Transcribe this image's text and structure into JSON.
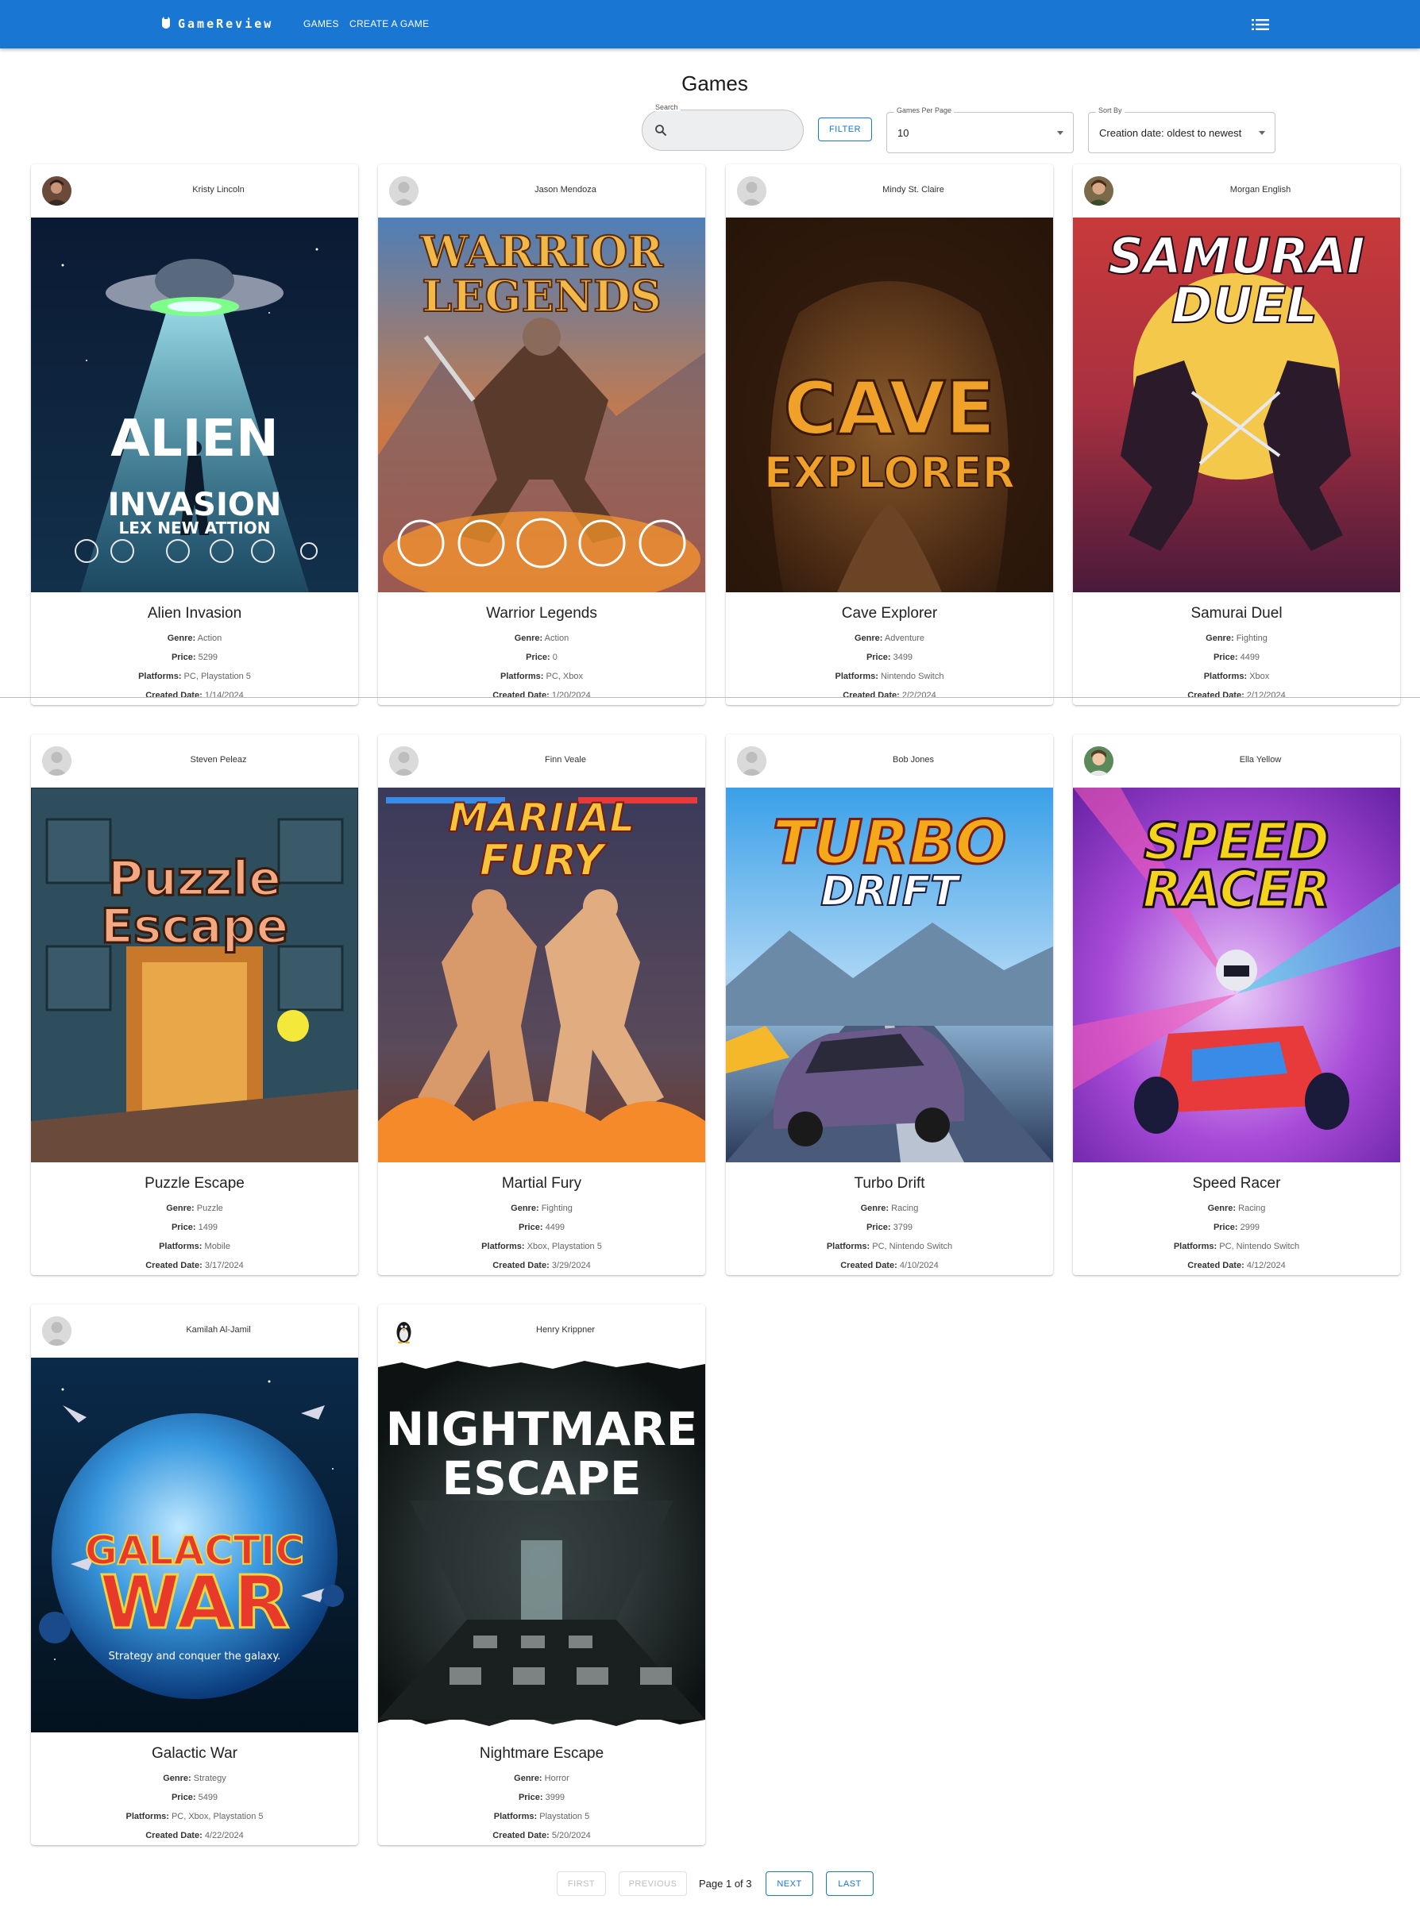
{
  "app": {
    "brand": "GameReview",
    "nav": [
      "GAMES",
      "CREATE A GAME"
    ],
    "brand_color": "#1976d2"
  },
  "page": {
    "title": "Games"
  },
  "controls": {
    "search_label": "Search",
    "search_value": "",
    "filter_label": "FILTER",
    "per_page_label": "Games Per Page",
    "per_page_value": "10",
    "sort_label": "Sort By",
    "sort_value": "Creation date: oldest to newest"
  },
  "field_labels": {
    "genre": "Genre:",
    "price": "Price:",
    "platforms": "Platforms:",
    "created": "Created Date:"
  },
  "games": [
    {
      "author": "Kristy Lincoln",
      "title": "Alien Invasion",
      "genre": "Action",
      "price": "5299",
      "platforms": "PC, Playstation 5",
      "created": "1/14/2024",
      "cover_lines": [
        "ALIEN",
        "INVASION",
        "LEX NEW ATTION"
      ],
      "cover_icon": "ufo-icon",
      "avatar": "photo"
    },
    {
      "author": "Jason Mendoza",
      "title": "Warrior Legends",
      "genre": "Action",
      "price": "0",
      "platforms": "PC, Xbox",
      "created": "1/20/2024",
      "cover_lines": [
        "WARRIOR",
        "LEGENDS"
      ],
      "cover_icon": "warrior-icon",
      "avatar": "default"
    },
    {
      "author": "Mindy St. Claire",
      "title": "Cave Explorer",
      "genre": "Adventure",
      "price": "3499",
      "platforms": "Nintendo Switch",
      "created": "2/2/2024",
      "cover_lines": [
        "CAVE",
        "EXPLORER"
      ],
      "cover_icon": "cave-icon",
      "avatar": "default"
    },
    {
      "author": "Morgan English",
      "title": "Samurai Duel",
      "genre": "Fighting",
      "price": "4499",
      "platforms": "Xbox",
      "created": "2/12/2024",
      "cover_lines": [
        "SAMURAI",
        "DUEL"
      ],
      "cover_icon": "samurai-icon",
      "avatar": "photo"
    },
    {
      "author": "Steven Peleaz",
      "title": "Puzzle Escape",
      "genre": "Puzzle",
      "price": "1499",
      "platforms": "Mobile",
      "created": "3/17/2024",
      "cover_lines": [
        "Puzzle",
        "Escape"
      ],
      "cover_icon": "puzzle-icon",
      "avatar": "default"
    },
    {
      "author": "Finn Veale",
      "title": "Martial Fury",
      "genre": "Fighting",
      "price": "4499",
      "platforms": "Xbox, Playstation 5",
      "created": "3/29/2024",
      "cover_lines": [
        "MARIIAL",
        "FURY"
      ],
      "cover_icon": "fighters-icon",
      "avatar": "default"
    },
    {
      "author": "Bob Jones",
      "title": "Turbo Drift",
      "genre": "Racing",
      "price": "3799",
      "platforms": "PC, Nintendo Switch",
      "created": "4/10/2024",
      "cover_lines": [
        "TURBO",
        "DRIFT"
      ],
      "cover_icon": "car-icon",
      "avatar": "default"
    },
    {
      "author": "Ella Yellow",
      "title": "Speed Racer",
      "genre": "Racing",
      "price": "2999",
      "platforms": "PC, Nintendo Switch",
      "created": "4/12/2024",
      "cover_lines": [
        "SPEED",
        "RACER"
      ],
      "cover_icon": "kart-icon",
      "avatar": "photo"
    },
    {
      "author": "Kamilah Al-Jamil",
      "title": "Galactic War",
      "genre": "Strategy",
      "price": "5499",
      "platforms": "PC, Xbox, Playstation 5",
      "created": "4/22/2024",
      "cover_lines": [
        "GALACTIC",
        "WAR",
        "Strategy and conquer the galaxy."
      ],
      "cover_icon": "planet-icon",
      "avatar": "default"
    },
    {
      "author": "Henry Krippner",
      "title": "Nightmare Escape",
      "genre": "Horror",
      "price": "3999",
      "platforms": "Playstation 5",
      "created": "5/20/2024",
      "cover_lines": [
        "NIGHTMARE",
        "ESCAPE"
      ],
      "cover_icon": "corridor-icon",
      "avatar": "penguin"
    }
  ],
  "pagination": {
    "first": "FIRST",
    "previous": "PREVIOUS",
    "info": "Page 1 of 3",
    "next": "NEXT",
    "last": "LAST"
  }
}
